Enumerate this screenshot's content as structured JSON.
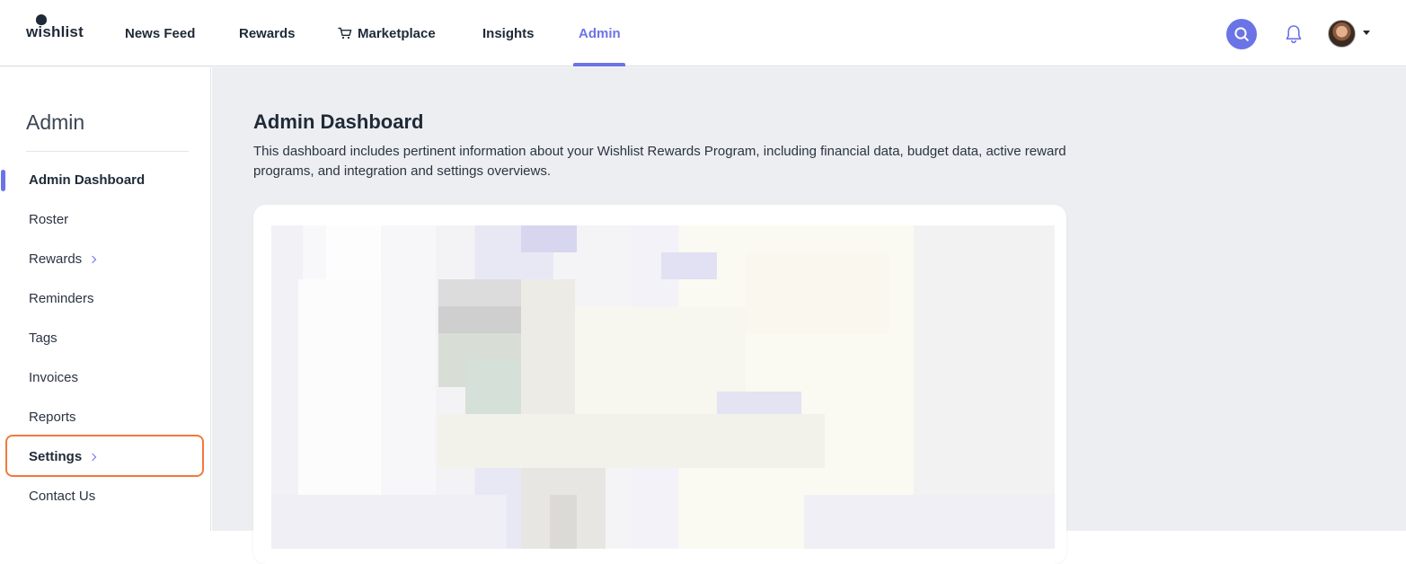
{
  "header": {
    "logo_text": "wishlist",
    "nav": [
      {
        "label": "News Feed"
      },
      {
        "label": "Rewards"
      },
      {
        "label": "Marketplace"
      },
      {
        "label": "Insights"
      },
      {
        "label": "Admin"
      }
    ],
    "accent_color": "#6b74e6",
    "icons": {
      "search": "search-icon",
      "notifications": "bell-icon",
      "cart": "cart-icon",
      "avatar_menu": "chevron-down-icon"
    }
  },
  "sidebar": {
    "title": "Admin",
    "items": [
      {
        "label": "Admin Dashboard"
      },
      {
        "label": "Roster"
      },
      {
        "label": "Rewards"
      },
      {
        "label": "Reminders"
      },
      {
        "label": "Tags"
      },
      {
        "label": "Invoices"
      },
      {
        "label": "Reports"
      },
      {
        "label": "Settings"
      },
      {
        "label": "Contact Us"
      }
    ],
    "highlight_color": "#f07a3c"
  },
  "main": {
    "title": "Admin Dashboard",
    "description": "This dashboard includes pertinent information about your Wishlist Rewards Program, including financial data, budget data, active reward programs, and integration and settings overviews."
  }
}
